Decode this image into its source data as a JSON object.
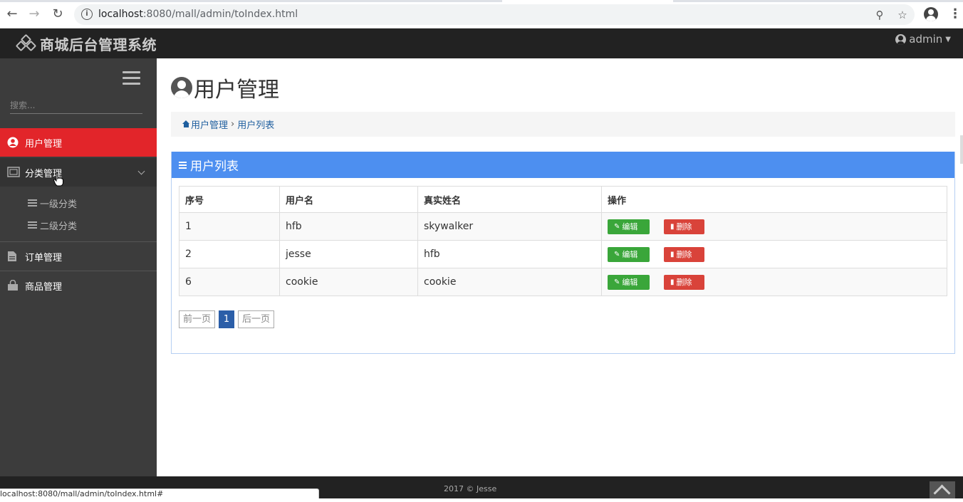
{
  "browser": {
    "url_host": "localhost",
    "url_path": ":8080/mall/admin/toIndex.html",
    "status_url": "localhost:8080/mall/admin/toIndex.html#"
  },
  "header": {
    "brand_title": "商城后台管理系统",
    "user_name": "admin"
  },
  "sidebar": {
    "search_placeholder": "搜索...",
    "items": [
      {
        "label": "用户管理",
        "icon": "user-circle-icon",
        "active": true
      },
      {
        "label": "分类管理",
        "icon": "category-icon",
        "expanded": true,
        "children": [
          {
            "label": "一级分类"
          },
          {
            "label": "二级分类"
          }
        ]
      },
      {
        "label": "订单管理",
        "icon": "file-icon"
      },
      {
        "label": "商品管理",
        "icon": "shopping-bag-icon"
      }
    ]
  },
  "main": {
    "page_title": "用户管理",
    "breadcrumb": {
      "home": "用户管理",
      "current": "用户列表"
    },
    "panel_title": "用户列表",
    "table": {
      "headers": [
        "序号",
        "用户名",
        "真实姓名",
        "操作"
      ],
      "rows": [
        {
          "id": "1",
          "username": "hfb",
          "realname": "skywalker"
        },
        {
          "id": "2",
          "username": "jesse",
          "realname": "hfb"
        },
        {
          "id": "6",
          "username": "cookie",
          "realname": "cookie"
        }
      ],
      "edit_label": "编辑",
      "delete_label": "删除"
    },
    "pager": {
      "prev": "前一页",
      "current": "1",
      "next": "后一页"
    }
  },
  "footer": {
    "text": "2017 © Jesse"
  },
  "colors": {
    "header_bg": "#222222",
    "sidebar_bg": "#3c3c3c",
    "active_item": "#e2252a",
    "panel_heading": "#4d8ff0",
    "edit_button": "#3aa63a",
    "delete_button": "#d9433a",
    "pager_current": "#2b5ea8"
  }
}
